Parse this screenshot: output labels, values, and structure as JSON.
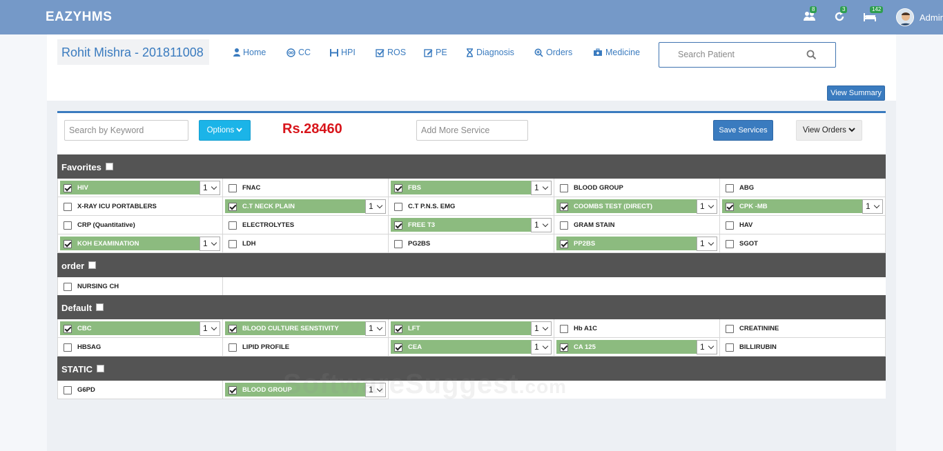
{
  "app": {
    "brand": "EAZYHMS"
  },
  "topbar": {
    "badges": {
      "users": "8",
      "refresh": "3",
      "beds": "142"
    },
    "user": "Admin"
  },
  "patient": {
    "name": "Rohit Mishra - 201811008"
  },
  "nav": [
    {
      "label": "Home",
      "icon": "user-icon"
    },
    {
      "label": "CC",
      "icon": "circle-icon"
    },
    {
      "label": "HPI",
      "icon": "h-icon"
    },
    {
      "label": "ROS",
      "icon": "checkbox-icon"
    },
    {
      "label": "PE",
      "icon": "edit-icon"
    },
    {
      "label": "Diagnosis",
      "icon": "hourglass-icon"
    },
    {
      "label": "Orders",
      "icon": "zoom-icon"
    },
    {
      "label": "Medicine",
      "icon": "medkit-icon"
    }
  ],
  "search": {
    "placeholder": "Search Patient"
  },
  "view_summary": "View Summary",
  "toolbar": {
    "keyword_placeholder": "Search by Keyword",
    "options_label": "Options",
    "amount": "Rs.28460",
    "add_service_placeholder": "Add More Service",
    "save_label": "Save Services",
    "view_orders_label": "View Orders"
  },
  "sections": [
    {
      "title": "Favorites",
      "items": [
        {
          "label": "HIV",
          "checked": true,
          "qty": "1"
        },
        {
          "label": "FNAC",
          "checked": false
        },
        {
          "label": "FBS",
          "checked": true,
          "qty": "1"
        },
        {
          "label": "BLOOD GROUP",
          "checked": false
        },
        {
          "label": "ABG",
          "checked": false
        },
        {
          "label": "X-RAY ICU PORTABLERS",
          "checked": false
        },
        {
          "label": "C.T NECK PLAIN",
          "checked": true,
          "qty": "1"
        },
        {
          "label": "C.T P.N.S. EMG",
          "checked": false
        },
        {
          "label": "COOMBS TEST (DIRECT)",
          "checked": true,
          "qty": "1"
        },
        {
          "label": "CPK -MB",
          "checked": true,
          "qty": "1"
        },
        {
          "label": "CRP (Quantitative)",
          "checked": false
        },
        {
          "label": "ELECTROLYTES",
          "checked": false
        },
        {
          "label": "FREE T3",
          "checked": true,
          "qty": "1"
        },
        {
          "label": "GRAM STAIN",
          "checked": false
        },
        {
          "label": "HAV",
          "checked": false
        },
        {
          "label": "KOH EXAMINATION",
          "checked": true,
          "qty": "1"
        },
        {
          "label": "LDH",
          "checked": false
        },
        {
          "label": "PG2BS",
          "checked": false
        },
        {
          "label": "PP2BS",
          "checked": true,
          "qty": "1"
        },
        {
          "label": "SGOT",
          "checked": false
        }
      ]
    },
    {
      "title": "order",
      "items": [
        {
          "label": "NURSING CH",
          "checked": false
        }
      ]
    },
    {
      "title": "Default",
      "items": [
        {
          "label": "CBC",
          "checked": true,
          "qty": "1"
        },
        {
          "label": "BLOOD CULTURE SENSTIVITY",
          "checked": true,
          "qty": "1"
        },
        {
          "label": "LFT",
          "checked": true,
          "qty": "1"
        },
        {
          "label": "Hb A1C",
          "checked": false
        },
        {
          "label": "CREATININE",
          "checked": false
        },
        {
          "label": "HBSAG",
          "checked": false
        },
        {
          "label": "LIPID PROFILE",
          "checked": false
        },
        {
          "label": "CEA",
          "checked": true,
          "qty": "1"
        },
        {
          "label": "CA 125",
          "checked": true,
          "qty": "1"
        },
        {
          "label": "BILLIRUBIN",
          "checked": false
        }
      ]
    },
    {
      "title": "STATIC",
      "items": [
        {
          "label": "G6PD",
          "checked": false
        },
        {
          "label": "BLOOD GROUP",
          "checked": true,
          "qty": "1"
        }
      ]
    }
  ],
  "watermark": {
    "main": "SoftwareSuggest",
    "suffix": ".com"
  },
  "colors": {
    "topbar": "#7599c8",
    "accent": "#3a7bbf",
    "selected": "#8cbb7f",
    "amount": "#d8151b",
    "section": "#545454"
  }
}
